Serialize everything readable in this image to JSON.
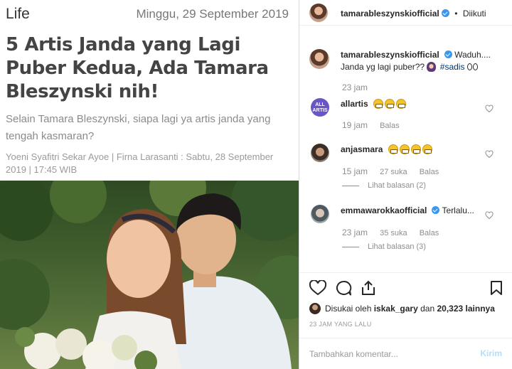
{
  "article": {
    "section": "Life",
    "date": "Minggu, 29 September 2019",
    "title": "5 Artis Janda yang Lagi Puber Kedua, Ada Tamara Bleszynski nih!",
    "lead": "Selain Tamara Bleszynski, siapa lagi ya artis janda yang tengah kasmaran?",
    "byline": "Yoeni Syafitri Sekar Ayoe | Firna Larasanti : Sabtu, 28 September 2019 | 17:45 WIB"
  },
  "instagram": {
    "header": {
      "username": "tamarableszynskiofficial",
      "separator": "•",
      "follow_status": "Diikuti"
    },
    "caption": {
      "username": "tamarableszynskiofficial",
      "text_1": "Waduh....",
      "text_2": "Janda yg lagi puber??",
      "hashtag": "#sadis",
      "time": "23 jam"
    },
    "comments": [
      {
        "username": "allartis",
        "avatar_text": "ALL ARTIS",
        "time": "19 jam",
        "likes": "",
        "reply": "Balas",
        "view_replies": ""
      },
      {
        "username": "anjasmara",
        "time": "15 jam",
        "likes": "27 suka",
        "reply": "Balas",
        "view_replies": "Lihat balasan (2)"
      },
      {
        "username": "emmawarokkaofficial",
        "text": "Terlalu...",
        "time": "23 jam",
        "likes": "35 suka",
        "reply": "Balas",
        "view_replies": "Lihat balasan (3)"
      }
    ],
    "likes": {
      "prefix": "Disukai oleh",
      "user": "iskak_gary",
      "connector": "dan",
      "count": "20,323 lainnya"
    },
    "time_ago": "23 JAM YANG LALU",
    "compose": {
      "placeholder": "Tambahkan komentar...",
      "submit": "Kirim"
    },
    "colors": {
      "verified": "#3897f0",
      "link": "#003569",
      "submit_disabled": "#b2dffc"
    }
  }
}
